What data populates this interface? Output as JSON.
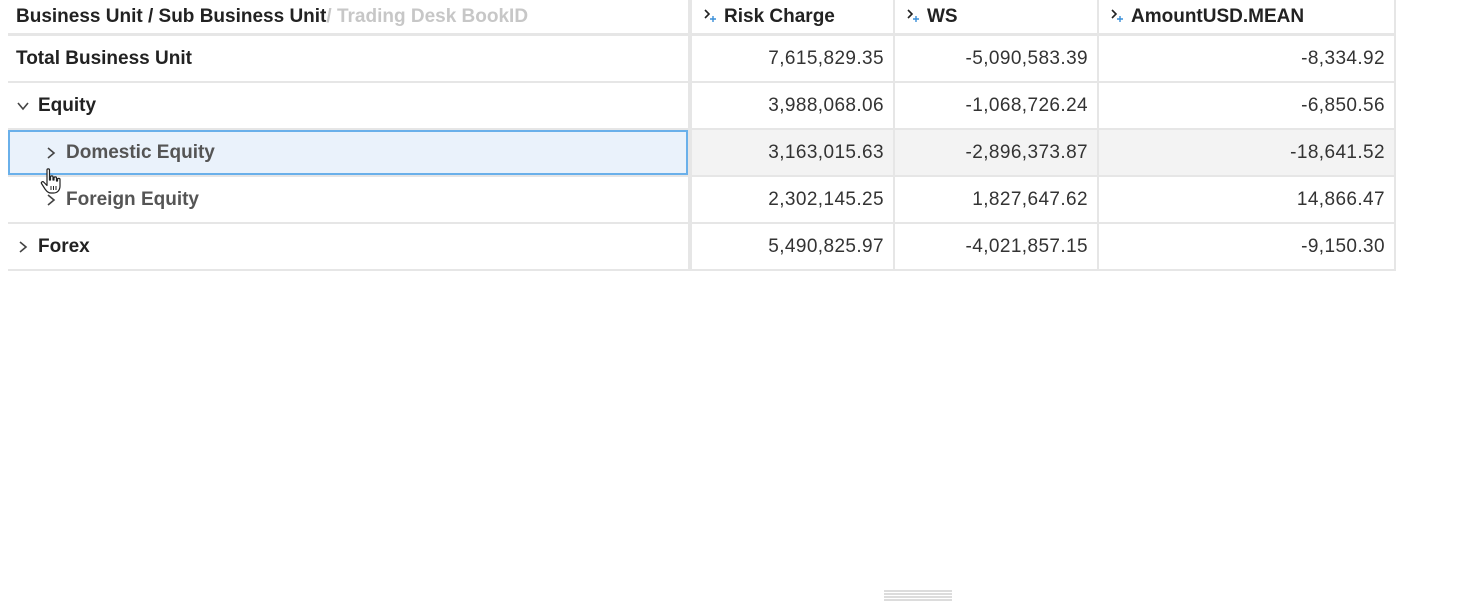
{
  "header": {
    "path_main": "Business Unit / Sub Business Unit",
    "path_muted": " / Trading Desk BookID",
    "columns": [
      "Risk Charge",
      "WS",
      "AmountUSD.MEAN"
    ]
  },
  "rows": [
    {
      "label": "Total Business Unit",
      "values": [
        "7,615,829.35",
        "-5,090,583.39",
        "-8,334.92"
      ],
      "expander": "none"
    },
    {
      "label": "Equity",
      "values": [
        "3,988,068.06",
        "-1,068,726.24",
        "-6,850.56"
      ],
      "expander": "expanded"
    },
    {
      "label": "Domestic Equity",
      "values": [
        "3,163,015.63",
        "-2,896,373.87",
        "-18,641.52"
      ],
      "expander": "collapsed",
      "selected": true
    },
    {
      "label": "Foreign Equity",
      "values": [
        "2,302,145.25",
        "1,827,647.62",
        "14,866.47"
      ],
      "expander": "collapsed"
    },
    {
      "label": "Forex",
      "values": [
        "5,490,825.97",
        "-4,021,857.15",
        "-9,150.30"
      ],
      "expander": "collapsed"
    }
  ],
  "icons": {
    "column_sort": "sort-expand-icon",
    "expanded": "chevron-down-icon",
    "collapsed": "chevron-right-icon",
    "cursor": "hand-cursor-icon",
    "resize": "resize-handle-icon"
  },
  "colors": {
    "selection_border": "#6ab0ea",
    "selection_fill": "#eaf2fb",
    "sort_icon_accent": "#3a8fd8"
  }
}
